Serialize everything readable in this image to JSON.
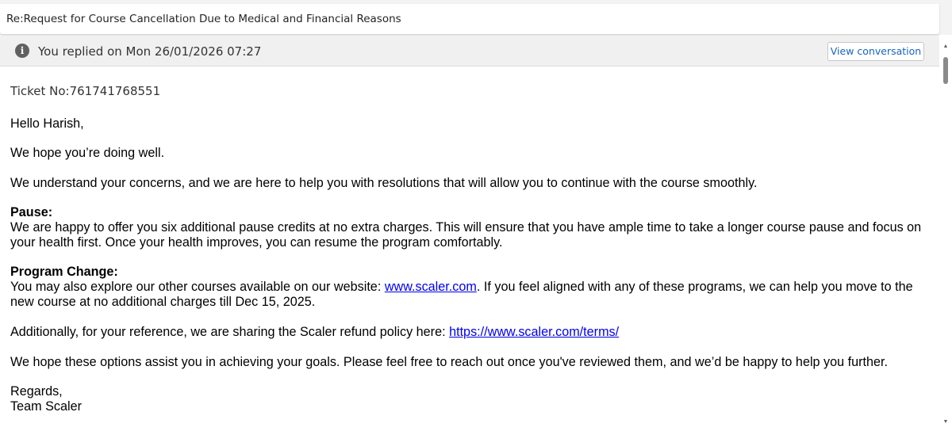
{
  "subject": "Re:Request for Course Cancellation Due to Medical and Financial Reasons",
  "reply_info": {
    "icon": "info-icon",
    "text": "You replied on Mon 26/01/2026 07:27",
    "view_button": "View conversation"
  },
  "email": {
    "ticket": "Ticket No:761741768551",
    "greeting": "Hello Harish,",
    "hope": "We hope you’re doing well.",
    "understand": "We understand your concerns, and we are here to help you with resolutions that will allow you to continue with the course smoothly.",
    "pause_heading": "Pause:",
    "pause_text": "We are happy to offer you six additional pause credits at no extra charges. This will ensure that you have ample time to take a longer course pause and focus on your health first. Once your health improves, you can resume the program comfortably.",
    "program_heading": "Program Change:",
    "program_text_before": "You may also explore our other courses available on our website: ",
    "program_link": "www.scaler.com",
    "program_text_after": ". If you feel aligned with any of these programs, we can help you move to the new course at no additional charges till Dec 15, 2025.",
    "refund_text": "Additionally, for your reference, we are sharing the Scaler refund policy here: ",
    "refund_link": "https://www.scaler.com/terms/",
    "closing": "We hope these options assist you in achieving your goals. Please feel free to reach out once you've reviewed them, and we’d be happy to help you further.",
    "regards": "Regards,",
    "signature": "Team Scaler"
  },
  "scrollbar": {
    "up_icon": "triangle-up-icon",
    "down_icon": "triangle-down-icon"
  }
}
